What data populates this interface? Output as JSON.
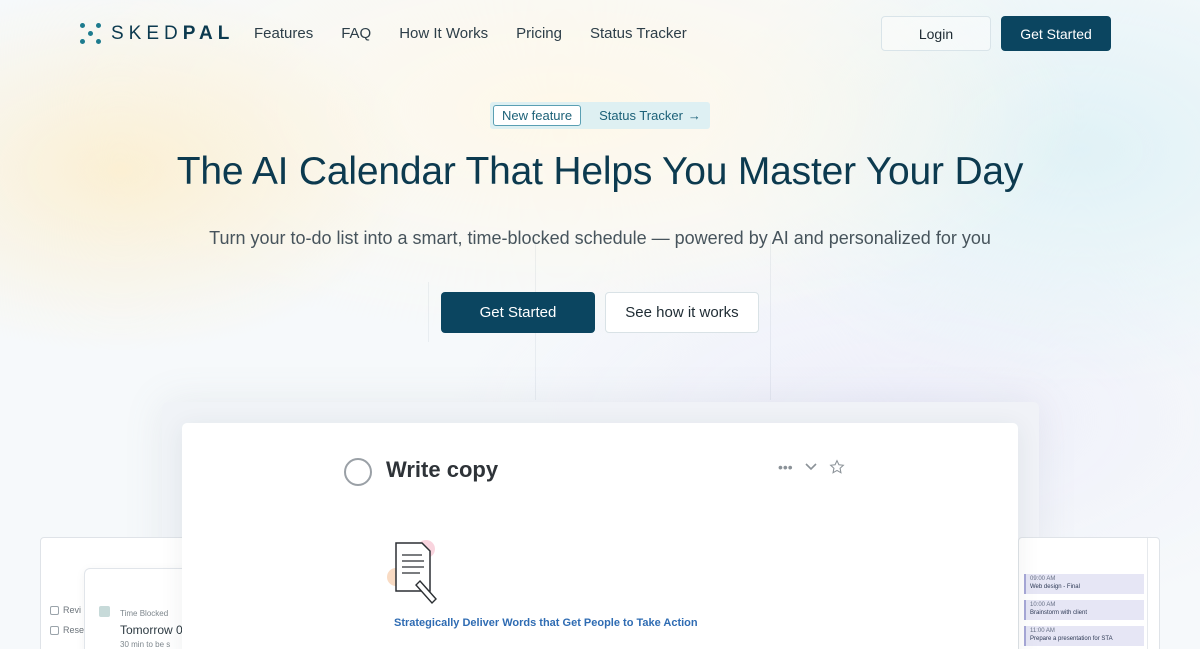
{
  "header": {
    "logo_light": "SKED",
    "logo_bold": "PAL",
    "nav": [
      "Features",
      "FAQ",
      "How It Works",
      "Pricing",
      "Status Tracker"
    ],
    "login_label": "Login",
    "get_started_label": "Get Started"
  },
  "badge": {
    "tag": "New feature",
    "link": "Status Tracker",
    "arrow": "→"
  },
  "hero": {
    "title": "The AI Calendar That Helps You Master Your Day",
    "subtitle": "Turn your to-do list into a smart, time-blocked schedule — powered by AI and personalized for you",
    "primary_cta": "Get Started",
    "secondary_cta": "See how it works"
  },
  "preview": {
    "task_title": "Write copy",
    "caption": "Strategically Deliver Words that Get People to Take Action",
    "left_panel": {
      "items": [
        "Revi",
        "Rese"
      ],
      "time_blocked_label": "Time Blocked",
      "time_blocked_value": "Tomorrow 0",
      "more": "30 min to be s"
    },
    "right_panel": {
      "events": [
        {
          "time": "09:00 AM",
          "title": "Web design - Final"
        },
        {
          "time": "10:00 AM",
          "title": "Brainstorm with client"
        },
        {
          "time": "11:00 AM",
          "title": "Prepare a presentation for STA"
        }
      ]
    },
    "icons": [
      "circle-check-icon",
      "more-dots-icon",
      "chevron-down-icon",
      "star-icon",
      "document-icon"
    ]
  },
  "colors": {
    "brand": "#0b4560",
    "accent": "#1d7b8e",
    "link_blue": "#2f6cb3"
  }
}
